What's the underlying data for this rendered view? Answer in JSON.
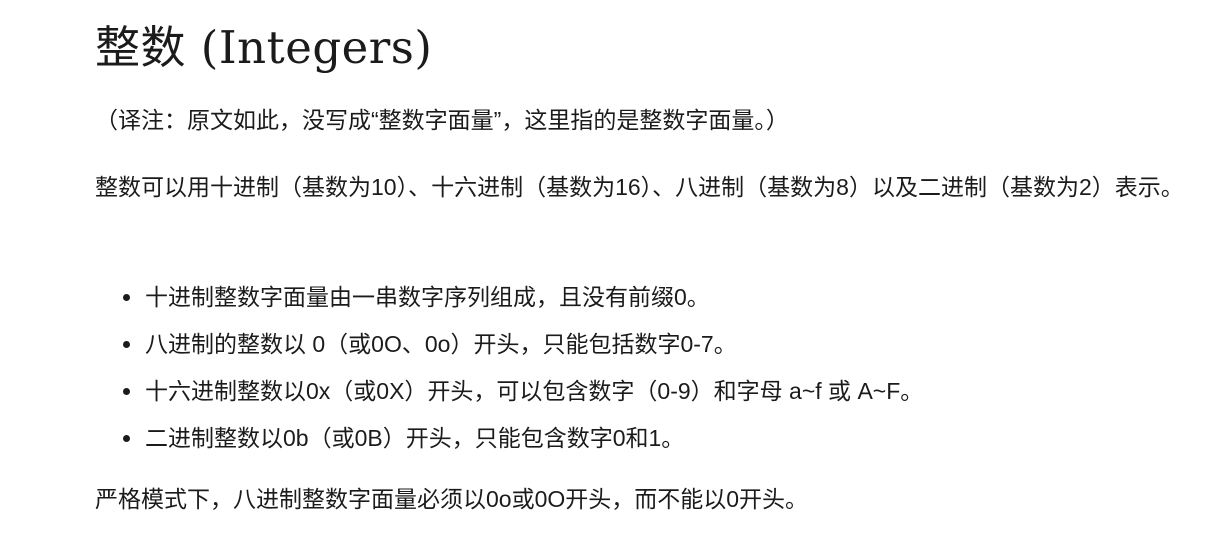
{
  "heading": "整数 (Integers)",
  "note": "（译注：原文如此，没写成“整数字面量”，这里指的是整数字面量。）",
  "intro": "整数可以用十进制（基数为10）、十六进制（基数为16）、八进制（基数为8）以及二进制（基数为2）表示。",
  "rules": [
    "十进制整数字面量由一串数字序列组成，且没有前缀0。",
    "八进制的整数以 0（或0O、0o）开头，只能包括数字0-7。",
    "十六进制整数以0x（或0X）开头，可以包含数字（0-9）和字母 a~f 或 A~F。",
    "二进制整数以0b（或0B）开头，只能包含数字0和1。"
  ],
  "strict_mode": "严格模式下，八进制整数字面量必须以0o或0O开头，而不能以0开头。"
}
